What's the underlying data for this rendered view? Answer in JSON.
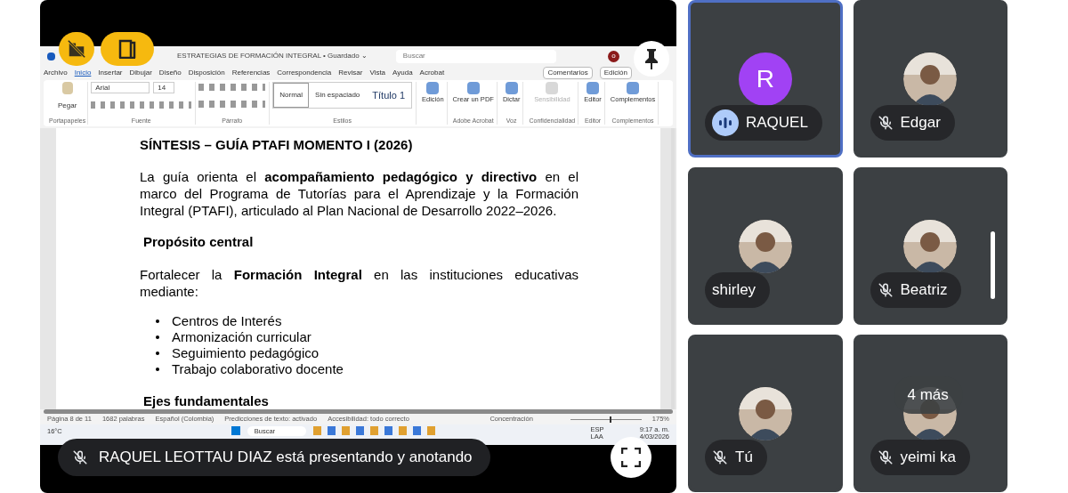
{
  "presentation": {
    "word": {
      "title": "ESTRATEGIAS DE FORMACIÓN INTEGRAL • Guardado ⌄",
      "search": {
        "placeholder": "Buscar"
      },
      "profile_initial": "o",
      "menu": [
        {
          "label": "Archivo",
          "selected": false
        },
        {
          "label": "Inicio",
          "selected": true
        },
        {
          "label": "Insertar",
          "selected": false
        },
        {
          "label": "Dibujar",
          "selected": false
        },
        {
          "label": "Diseño",
          "selected": false
        },
        {
          "label": "Disposición",
          "selected": false
        },
        {
          "label": "Referencias",
          "selected": false
        },
        {
          "label": "Correspondencia",
          "selected": false
        },
        {
          "label": "Revisar",
          "selected": false
        },
        {
          "label": "Vista",
          "selected": false
        },
        {
          "label": "Ayuda",
          "selected": false
        },
        {
          "label": "Acrobat",
          "selected": false
        }
      ],
      "comments_button": "Comentarios",
      "editing_button": "Edición",
      "font": "Arial",
      "size": "14",
      "styles": [
        {
          "label": "Normal",
          "selected": true
        },
        {
          "label": "Sin espaciado",
          "selected": false
        },
        {
          "label": "Título 1",
          "selected": false
        }
      ],
      "tools": [
        {
          "label": "Edición",
          "disabled": false
        },
        {
          "label": "Crear un PDF",
          "group": "Adobe Acrobat",
          "disabled": false
        },
        {
          "label": "Dictar",
          "group": "Voz",
          "disabled": false
        },
        {
          "label": "Sensibilidad",
          "group": "Confidencialidad",
          "disabled": true
        },
        {
          "label": "Editor",
          "group": "Editor",
          "disabled": false
        },
        {
          "label": "Complementos",
          "group": "Complementos",
          "disabled": false
        }
      ],
      "groups": [
        "Portapapeles",
        "Fuente",
        "Párrafo",
        "Estilos"
      ],
      "paste": "Pegar",
      "document": [
        {
          "kind": "title",
          "text": "SÍNTESIS – GUÍA PTAFI MOMENTO I (2026)"
        },
        {
          "kind": "paragraph",
          "text": "La guía orienta el **acompañamiento pedagógico y directivo** en el marco del Programa de Tutorías para el Aprendizaje y la Formación Integral (PTAFI), articulado al Plan Nacional de Desarrollo 2022–2026."
        },
        {
          "kind": "heading",
          "text": "Propósito central"
        },
        {
          "kind": "paragraph",
          "text": "Fortalecer la **Formación Integral** en las instituciones educativas mediante:"
        },
        {
          "kind": "bullets",
          "items": [
            "Centros de Interés",
            "Armonización curricular",
            "Seguimiento pedagógico",
            "Trabajo colaborativo docente"
          ]
        },
        {
          "kind": "heading",
          "text": "Ejes fundamentales"
        }
      ],
      "status": [
        "Página 8 de 11",
        "1682 palabras",
        "Español (Colombia)",
        "Predicciones de texto: activado",
        "Accesibilidad: todo correcto"
      ],
      "focus": "Concentración",
      "zoom": "175%",
      "zoom_slider": {
        "level": 0.55
      },
      "taskbar": {
        "weather": "16°C",
        "search": "Buscar",
        "lang": "ESP",
        "lang2": "LAA",
        "time": "9:17 a. m.",
        "date": "4/03/2026"
      }
    },
    "banner": "RAQUEL LEOTTAU DIAZ está presentando y anotando"
  },
  "participants": [
    {
      "name": "RAQUEL",
      "kind": "letter",
      "letter": "R",
      "muted": false,
      "speaking": true,
      "selected": true
    },
    {
      "name": "Edgar",
      "kind": "picture",
      "muted": true,
      "speaking": false,
      "selected": false
    },
    {
      "name": "shirley",
      "kind": "picture",
      "muted": false,
      "speaking": false,
      "selected": false
    },
    {
      "name": "Beatriz",
      "kind": "picture",
      "muted": true,
      "speaking": false,
      "selected": false
    },
    {
      "name": "Tú",
      "kind": "picture",
      "muted": true,
      "speaking": false,
      "selected": false
    },
    {
      "name": "yeimi ka",
      "kind": "picture",
      "muted": true,
      "speaking": false,
      "selected": false,
      "more": "4 más"
    }
  ]
}
